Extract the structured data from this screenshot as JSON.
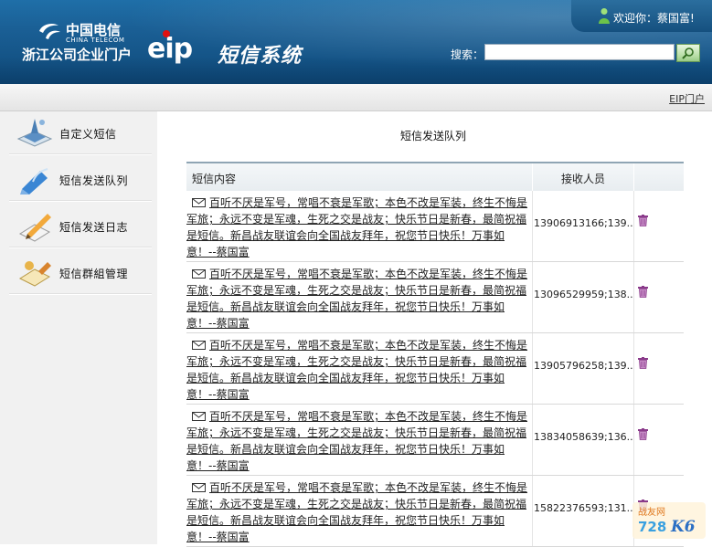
{
  "header": {
    "logo_cn": "中国电信",
    "logo_en": "CHINA TELECOM",
    "company": "浙江公司企业门户",
    "eip_logo": "eip",
    "system_title": "短信系统",
    "welcome": "欢迎你：蔡国富!",
    "search_label": "搜索：",
    "search_value": ""
  },
  "toolbar": {
    "eip_link": "EIP门户"
  },
  "sidebar": {
    "items": [
      {
        "label": "自定义短信",
        "icon": "custom-sms-icon"
      },
      {
        "label": "短信发送队列",
        "icon": "sms-queue-icon"
      },
      {
        "label": "短信发送日志",
        "icon": "sms-log-icon"
      },
      {
        "label": "短信群組管理",
        "icon": "sms-group-icon"
      }
    ]
  },
  "main": {
    "title": "短信发送队列",
    "columns": [
      "短信内容",
      "接收人员"
    ],
    "rows": [
      {
        "line1": "百听不厌是军号，常唱不衰是军歌；本色不改是军装，终生不悔是",
        "line2": "军旅；永远不变是军魂，生死之交是战友；快乐节日是新春，最简祝福",
        "line3": "是短信。新昌战友联谊会向全国战友拜年，祝您节日快乐！万事如",
        "line4": "意！--蔡国富",
        "recipients": "13906913166;139..."
      },
      {
        "line1": "百听不厌是军号，常唱不衰是军歌；本色不改是军装，终生不悔是",
        "line2": "军旅；永远不变是军魂，生死之交是战友；快乐节日是新春，最简祝福",
        "line3": "是短信。新昌战友联谊会向全国战友拜年，祝您节日快乐！万事如",
        "line4": "意！--蔡国富",
        "recipients": "13096529959;138..."
      },
      {
        "line1": "百听不厌是军号，常唱不衰是军歌；本色不改是军装，终生不悔是",
        "line2": "军旅；永远不变是军魂，生死之交是战友；快乐节日是新春，最简祝福",
        "line3": "是短信。新昌战友联谊会向全国战友拜年，祝您节日快乐！万事如",
        "line4": "意！--蔡国富",
        "recipients": "13905796258;139..."
      },
      {
        "line1": "百听不厌是军号，常唱不衰是军歌；本色不改是军装，终生不悔是",
        "line2": "军旅；永远不变是军魂，生死之交是战友；快乐节日是新春，最简祝福",
        "line3": "是短信。新昌战友联谊会向全国战友拜年，祝您节日快乐！万事如",
        "line4": "意！--蔡国富",
        "recipients": "13834058639;136..."
      },
      {
        "line1": "百听不厌是军号，常唱不衰是军歌；本色不改是军装，终生不悔是",
        "line2": "军旅；永远不变是军魂，生死之交是战友；快乐节日是新春，最简祝福",
        "line3": "是短信。新昌战友联谊会向全国战友拜年，祝您节日快乐！万事如",
        "line4": "意！--蔡国富",
        "recipients": "15822376593;131..."
      }
    ]
  },
  "watermark": {
    "text_top": "战友网",
    "text_bottom": "728",
    "text_brand": "K6"
  },
  "colors": {
    "header_blue": "#1a5f95",
    "accent_green": "#6a9f58",
    "trash_purple": "#8a3a8a"
  }
}
